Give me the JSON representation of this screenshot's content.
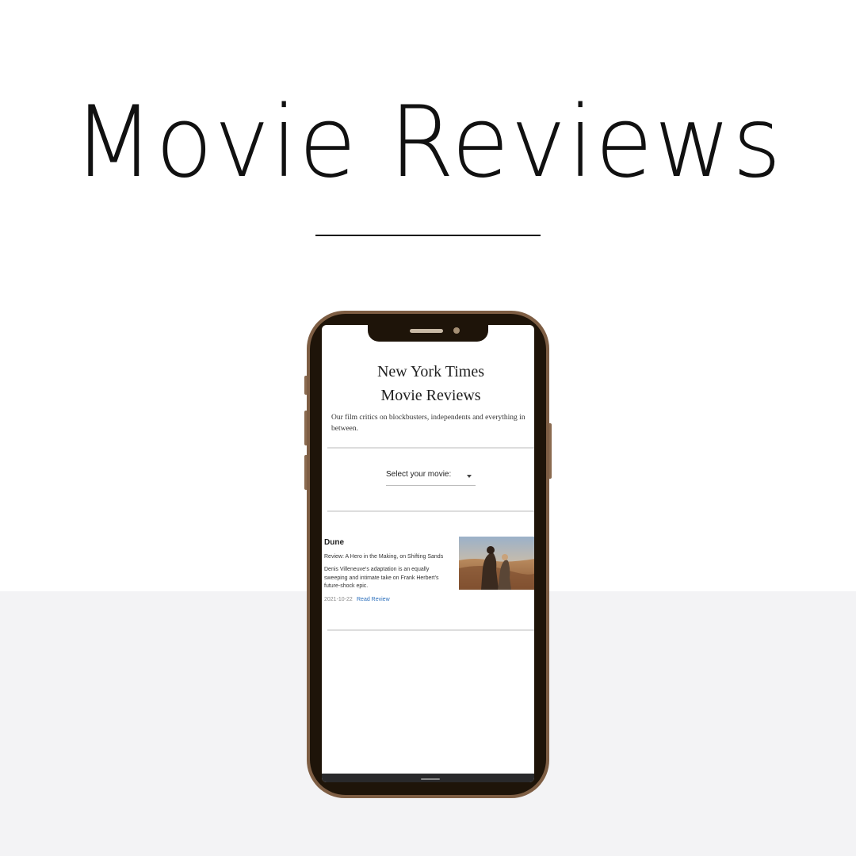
{
  "page": {
    "headline": "Movie Reviews"
  },
  "app": {
    "title_line1": "New York Times",
    "title_line2": "Movie Reviews",
    "subtitle": "Our film critics on blockbusters, independents and everything in between.",
    "select": {
      "label": "Select your movie:",
      "arrow_icon": "dropdown-arrow-icon"
    },
    "reviews": [
      {
        "title": "Dune",
        "headline": "Review: A Hero in the Making, on Shifting Sands",
        "summary": "Denis Villeneuve's adaptation is an equally sweeping and intimate take on Frank Herbert's future-shock epic.",
        "date": "2021-10-22",
        "link_label": "Read Review"
      }
    ]
  },
  "colors": {
    "background_band": "#f3f3f5",
    "phone_frame": "#7e5e44",
    "phone_bezel": "#1e1409",
    "link": "#2a6ebb"
  }
}
